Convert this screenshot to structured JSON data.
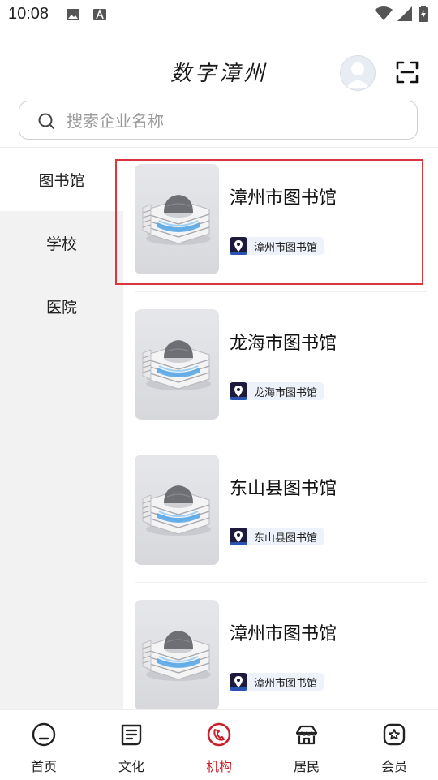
{
  "status_bar": {
    "time": "10:08"
  },
  "header": {
    "title": "数字漳州"
  },
  "search": {
    "placeholder": "搜索企业名称"
  },
  "sidebar": {
    "items": [
      {
        "label": "图书馆",
        "active": true
      },
      {
        "label": "学校",
        "active": false
      },
      {
        "label": "医院",
        "active": false
      }
    ]
  },
  "list": {
    "items": [
      {
        "title": "漳州市图书馆",
        "tag": "漳州市图书馆"
      },
      {
        "title": "龙海市图书馆",
        "tag": "龙海市图书馆"
      },
      {
        "title": "东山县图书馆",
        "tag": "东山县图书馆"
      },
      {
        "title": "漳州市图书馆",
        "tag": "漳州市图书馆"
      }
    ]
  },
  "bottom_nav": {
    "items": [
      {
        "label": "首页",
        "icon": "home-icon",
        "active": false
      },
      {
        "label": "文化",
        "icon": "culture-icon",
        "active": false
      },
      {
        "label": "机构",
        "icon": "institution-icon",
        "active": true
      },
      {
        "label": "居民",
        "icon": "resident-icon",
        "active": false
      },
      {
        "label": "会员",
        "icon": "member-icon",
        "active": false
      }
    ]
  },
  "colors": {
    "accent": "#c8202a",
    "highlight_border": "#d9363e",
    "sidebar_bg": "#f2f2f2",
    "tag_bg": "#eef2fb"
  }
}
